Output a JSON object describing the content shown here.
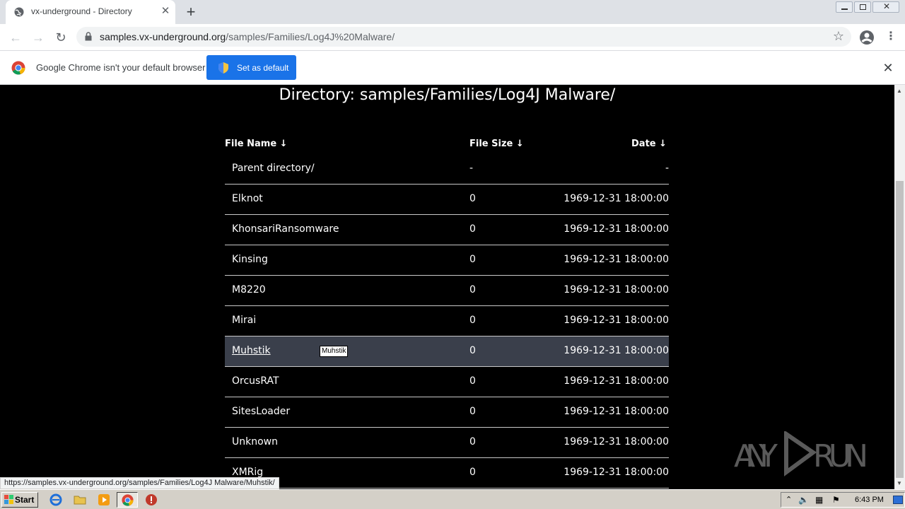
{
  "browser": {
    "tab_title": "vx-underground - Directory",
    "new_tab_symbol": "+",
    "url_host": "samples.vx-underground.org",
    "url_path": "/samples/Families/Log4J%20Malware/"
  },
  "infobar": {
    "message": "Google Chrome isn't your default browser",
    "button_label": "Set as default"
  },
  "page": {
    "title": "Directory: samples/Families/Log4J Malware/",
    "columns": {
      "name": "File Name  ↓",
      "size": "File Size  ↓",
      "date": "Date  ↓"
    },
    "rows": [
      {
        "name": "Parent directory/",
        "size": "-",
        "date": "-"
      },
      {
        "name": "Elknot",
        "size": "0",
        "date": "1969-12-31 18:00:00"
      },
      {
        "name": "KhonsariRansomware",
        "size": "0",
        "date": "1969-12-31 18:00:00"
      },
      {
        "name": "Kinsing",
        "size": "0",
        "date": "1969-12-31 18:00:00"
      },
      {
        "name": "M8220",
        "size": "0",
        "date": "1969-12-31 18:00:00"
      },
      {
        "name": "Mirai",
        "size": "0",
        "date": "1969-12-31 18:00:00"
      },
      {
        "name": "Muhstik",
        "size": "0",
        "date": "1969-12-31 18:00:00"
      },
      {
        "name": "OrcusRAT",
        "size": "0",
        "date": "1969-12-31 18:00:00"
      },
      {
        "name": "SitesLoader",
        "size": "0",
        "date": "1969-12-31 18:00:00"
      },
      {
        "name": "Unknown",
        "size": "0",
        "date": "1969-12-31 18:00:00"
      },
      {
        "name": "XMRig",
        "size": "0",
        "date": "1969-12-31 18:00:00"
      }
    ],
    "tooltip": "Muhstik"
  },
  "watermark": "ANY RUN",
  "status_url": "https://samples.vx-underground.org/samples/Families/Log4J Malware/Muhstik/",
  "taskbar": {
    "start_label": "Start",
    "clock": "6:43 PM"
  }
}
